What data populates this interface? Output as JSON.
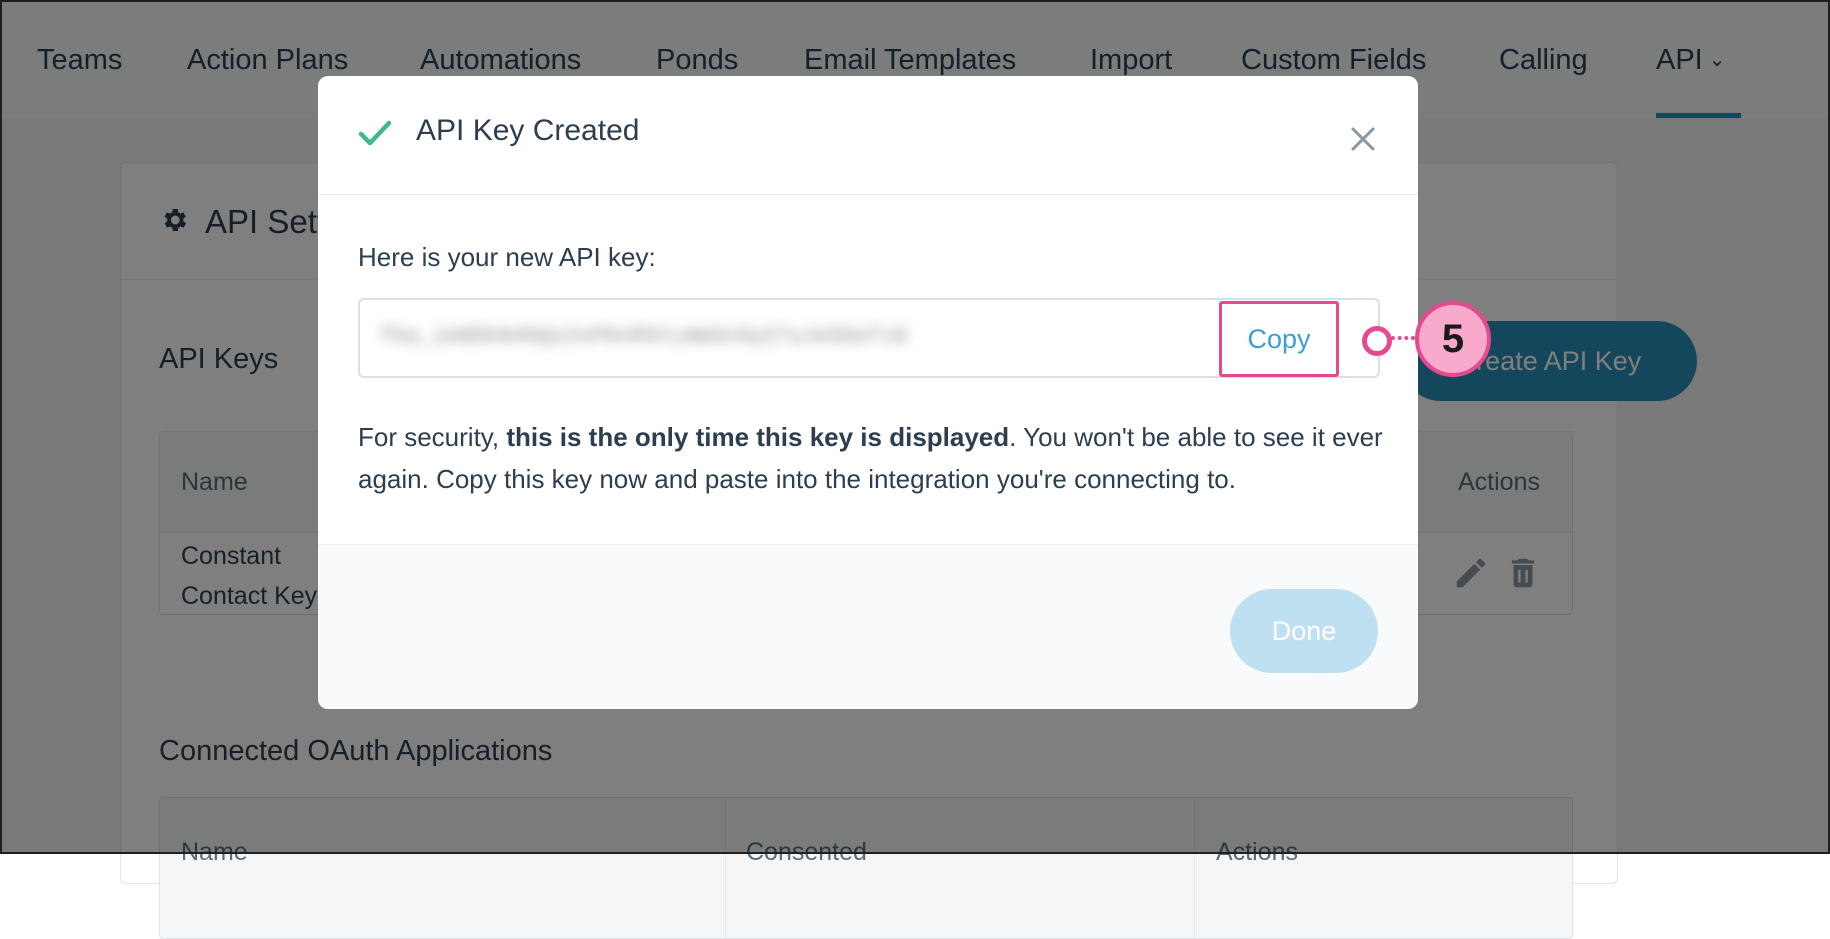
{
  "nav": {
    "tabs": [
      {
        "label": "Teams"
      },
      {
        "label": "Action Plans"
      },
      {
        "label": "Automations"
      },
      {
        "label": "Ponds"
      },
      {
        "label": "Email Templates"
      },
      {
        "label": "Import"
      },
      {
        "label": "Custom Fields"
      },
      {
        "label": "Calling"
      },
      {
        "label": "API",
        "active": true,
        "icon": "chevron-down-icon"
      }
    ]
  },
  "page": {
    "title": "API Settings",
    "title_icon": "gear-icon",
    "api_keys": {
      "title": "API Keys",
      "create_button": "Create API Key",
      "columns": [
        "Name",
        "Actions"
      ],
      "rows": [
        {
          "name": "Constant Contact Key",
          "actions": [
            "pencil-icon",
            "trash-icon"
          ]
        }
      ]
    },
    "oauth": {
      "title": "Connected OAuth Applications",
      "columns": [
        "Name",
        "Consented",
        "Actions"
      ]
    }
  },
  "modal": {
    "title": "API Key Created",
    "title_icon": "check-icon",
    "close_icon": "close-icon",
    "intro": "Here is your new API key:",
    "api_key": "fka_1A8DkN4bQs2xP0vR9tLmW3cHyZ7uJe5GoTi6",
    "copy_label": "Copy",
    "security_prefix": "For security, ",
    "security_bold": "this is the only time this key is displayed",
    "security_suffix": ". You won't be able to see it ever again. Copy this key now and paste into the integration you're connecting to.",
    "done_label": "Done"
  },
  "callout": {
    "step": "5"
  },
  "colors": {
    "accent": "#2b8fb8",
    "highlight": "#e5498f",
    "success": "#3dba8c",
    "done_disabled": "#bfe0f1"
  }
}
